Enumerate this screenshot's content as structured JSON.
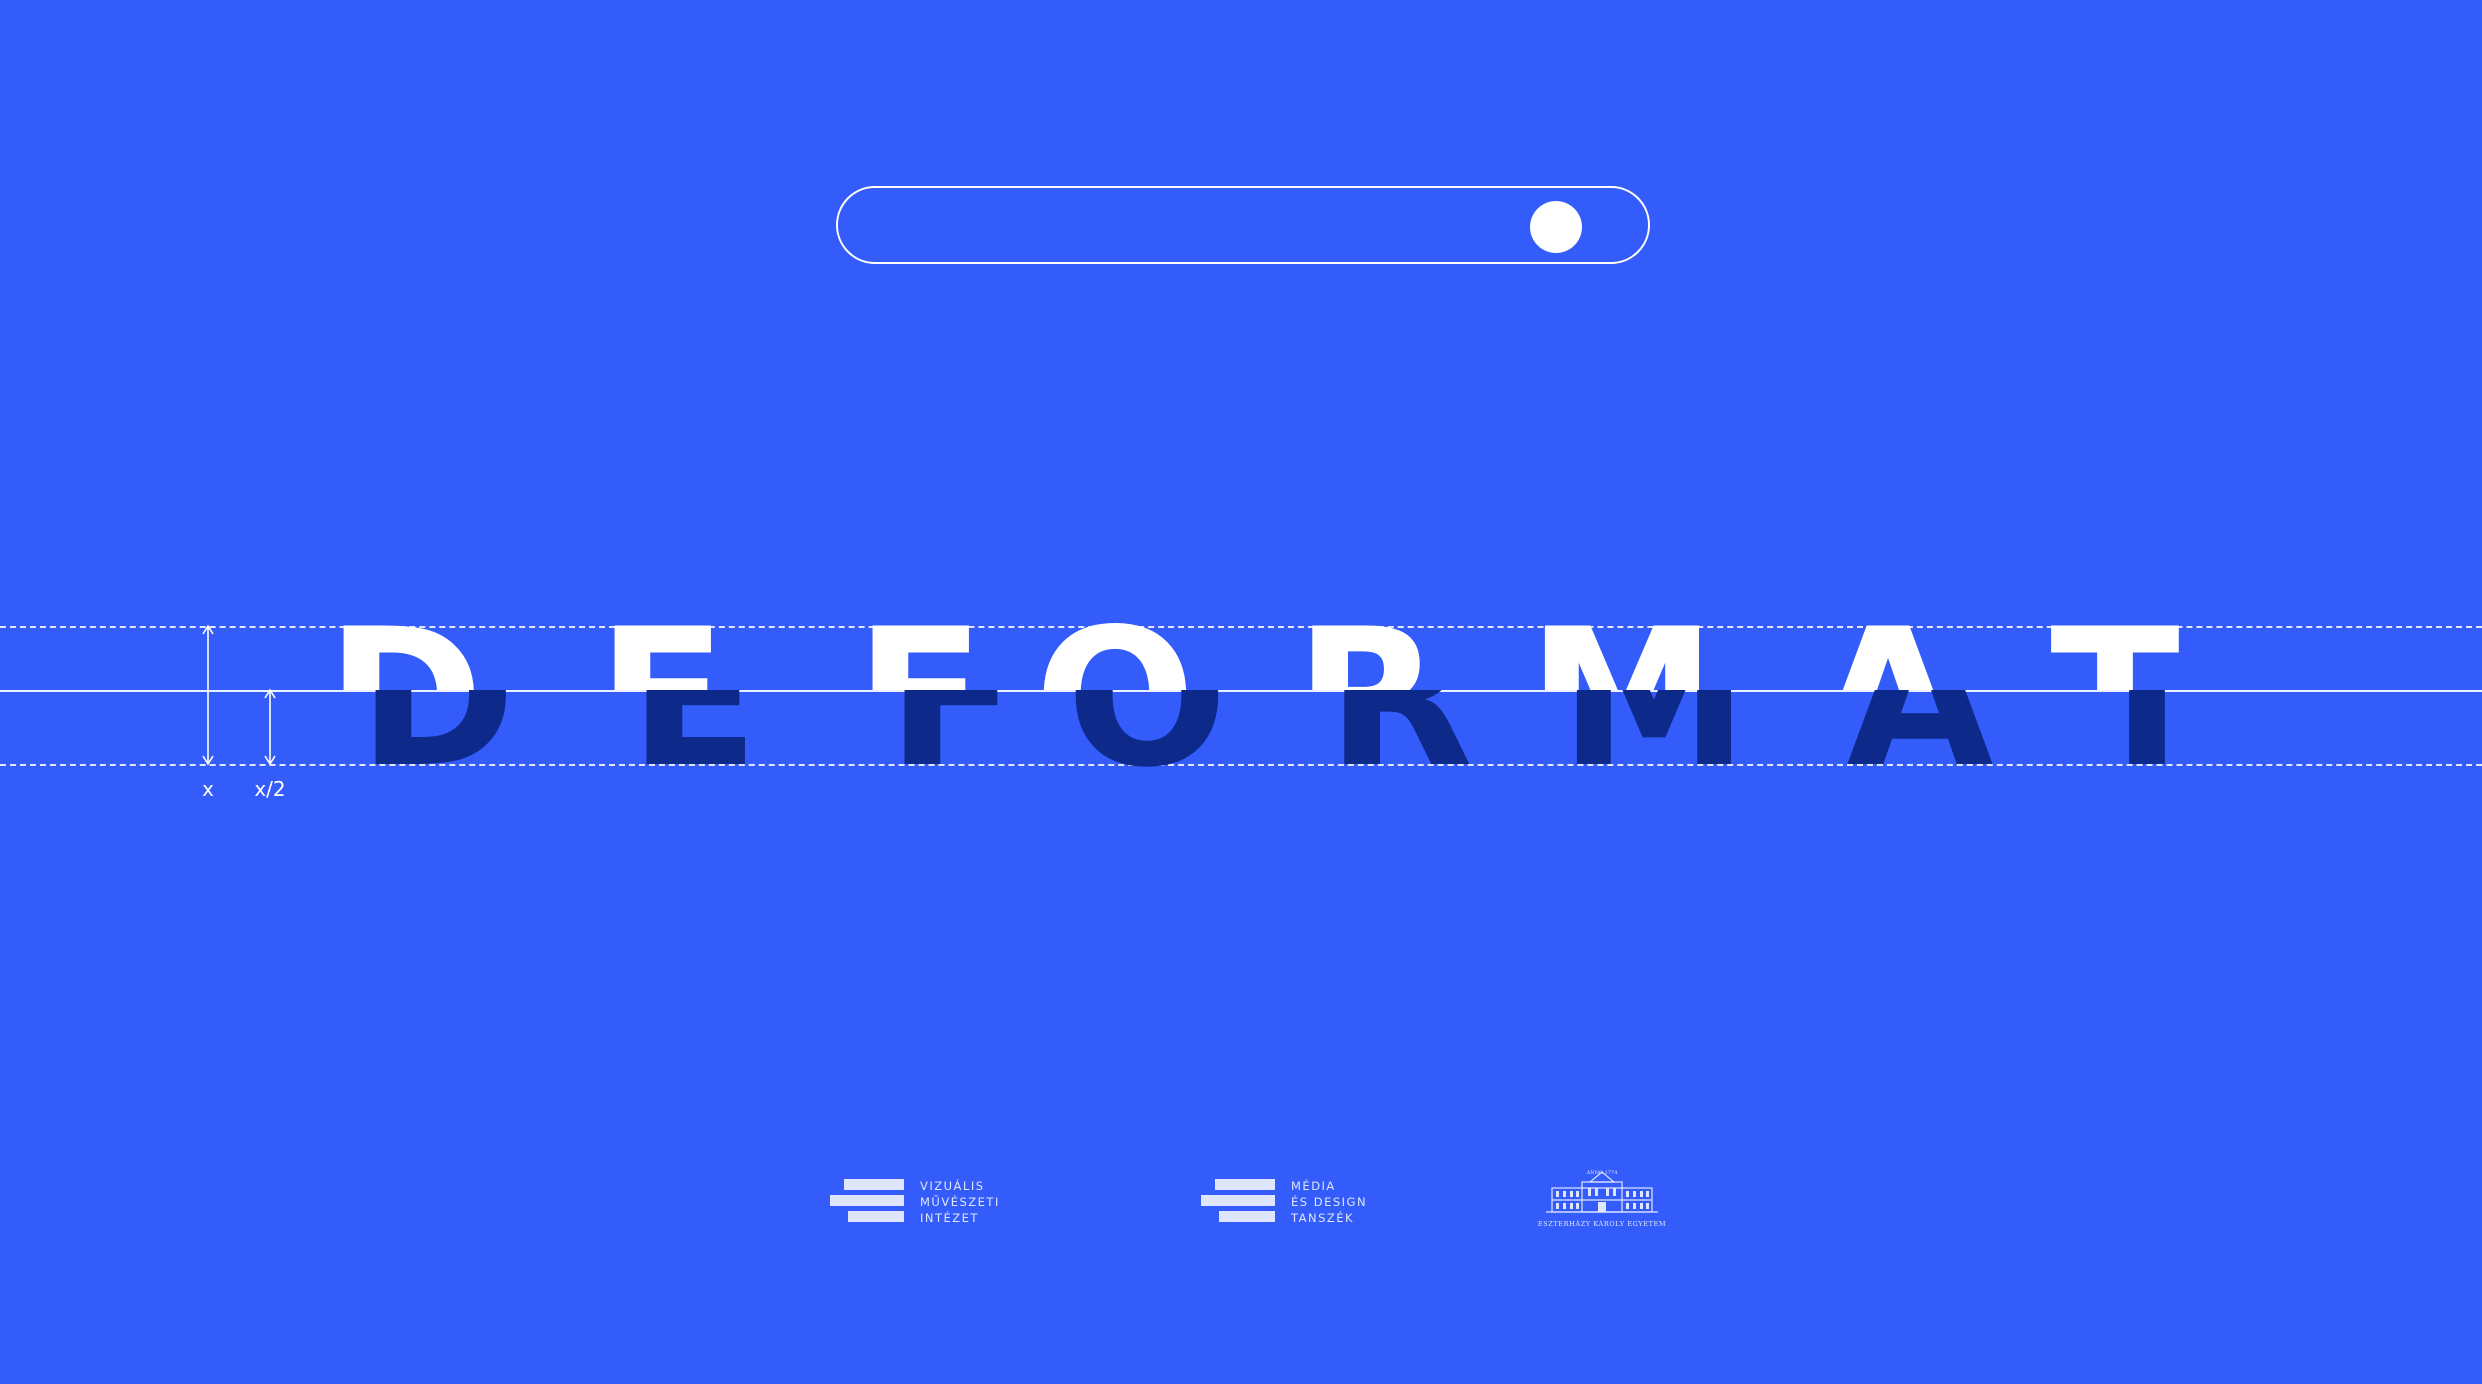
{
  "wordmark": {
    "letters": [
      "D",
      "E",
      "F",
      "O",
      "R",
      "M",
      "A",
      "T"
    ]
  },
  "toggle": {
    "state": "on"
  },
  "measure": {
    "full_label": "x",
    "half_label": "x/2"
  },
  "logos": [
    {
      "lines": [
        "VIZUÁLIS",
        "MŰVÉSZETI",
        "INTÉZET"
      ]
    },
    {
      "lines": [
        "MÉDIA",
        "ÉS DESIGN",
        "TANSZÉK"
      ]
    },
    {
      "caption": "ESZTERHÁZY KÁROLY EGYETEM",
      "seal_text": "ANNO 1774"
    }
  ],
  "colors": {
    "background": "#335cfb",
    "foreground": "#ffffff",
    "shadow": "#0d2a8a"
  }
}
